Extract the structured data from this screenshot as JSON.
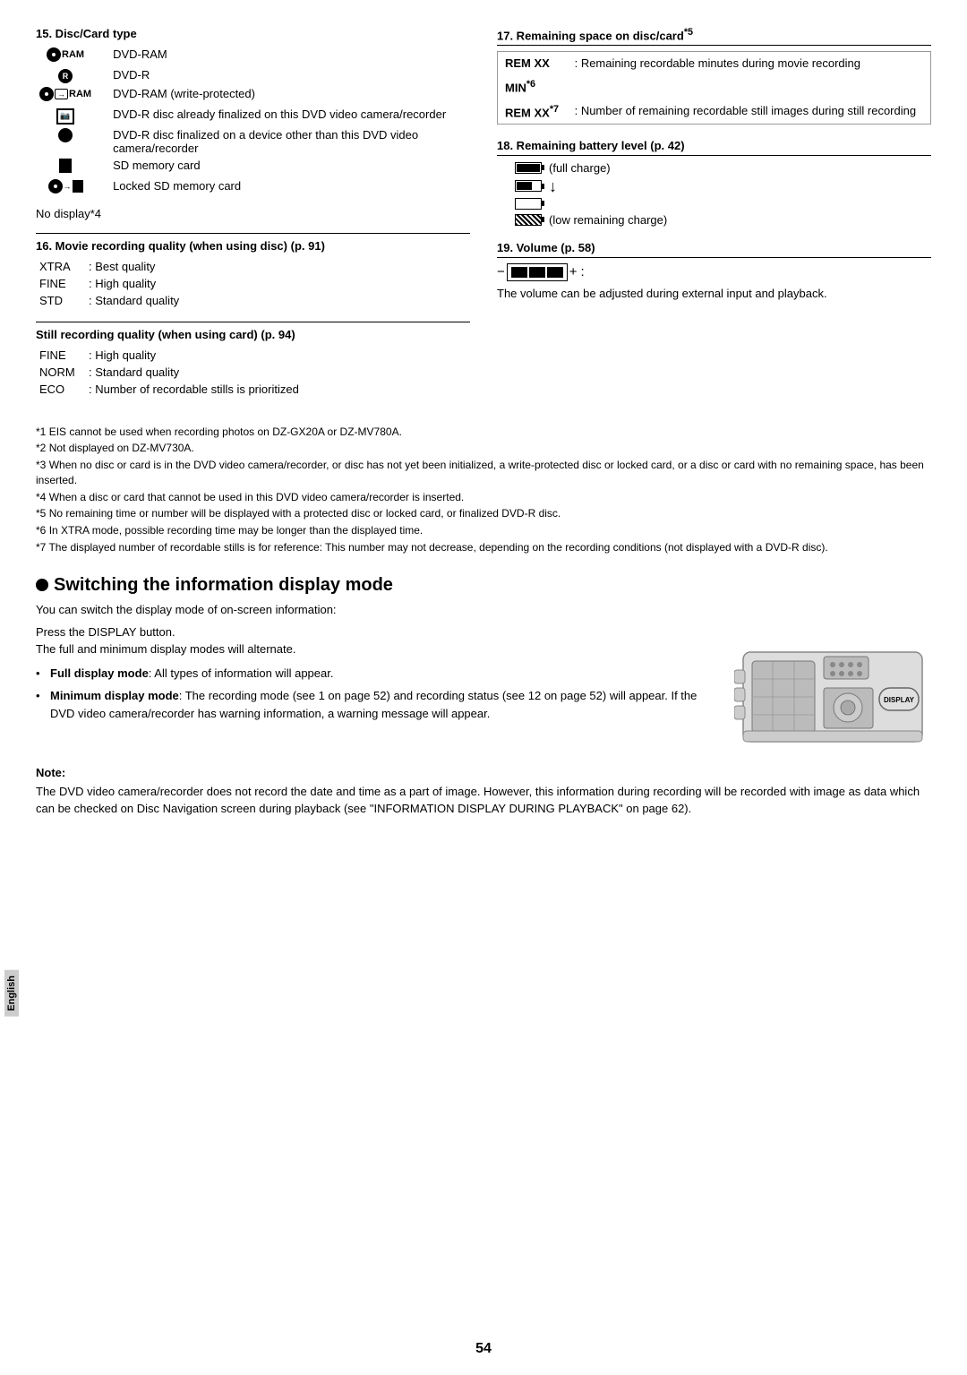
{
  "page": {
    "number": "54",
    "language_label": "English"
  },
  "section15": {
    "title": "15. Disc/Card type",
    "items": [
      {
        "icon_type": "ram",
        "description": ": DVD-RAM"
      },
      {
        "icon_type": "r",
        "description": ": DVD-R"
      },
      {
        "icon_type": "ram_wp",
        "description": ": DVD-RAM (write-protected)"
      },
      {
        "icon_type": "finalized_cam",
        "description": ": DVD-R disc already finalized on this DVD video camera/recorder"
      },
      {
        "icon_type": "circle_filled",
        "description": ": DVD-R disc finalized on a device other than this DVD video camera/recorder"
      },
      {
        "icon_type": "black_sq",
        "description": ": SD memory card"
      },
      {
        "icon_type": "locked_sd",
        "description": ": Locked SD memory card"
      }
    ],
    "no_display": "No display*4"
  },
  "section16": {
    "title": "16. Movie recording quality (when using disc)",
    "page_ref": "(p. 91)",
    "items": [
      {
        "label": "XTRA",
        "desc": ": Best quality"
      },
      {
        "label": "FINE",
        "desc": ": High quality"
      },
      {
        "label": "STD",
        "desc": ": Standard quality"
      }
    ],
    "still_title": "Still recording quality (when using card)",
    "still_page_ref": "(p. 94)",
    "still_items": [
      {
        "label": "FINE",
        "desc": ": High quality"
      },
      {
        "label": "NORM",
        "desc": ": Standard quality"
      },
      {
        "label": "ECO",
        "desc": ": Number of recordable stills is prioritized"
      }
    ]
  },
  "section17": {
    "title": "17. Remaining space on disc/card",
    "title_sup": "*5",
    "rows": [
      {
        "label": "REM XX",
        "desc": ": Remaining recordable minutes"
      },
      {
        "label": "MIN*6",
        "desc": "during movie recording"
      },
      {
        "label": "REM XX*7",
        "desc": ": Number of remaining recordable still images during still recording"
      }
    ]
  },
  "section18": {
    "title": "18. Remaining battery level (p. 42)",
    "battery_levels": [
      {
        "icon": "full",
        "label": "(full charge)"
      },
      {
        "icon": "half",
        "label": ""
      },
      {
        "icon": "arrow",
        "label": ""
      },
      {
        "icon": "empty",
        "label": ""
      },
      {
        "icon": "low",
        "label": "(low remaining charge)"
      }
    ]
  },
  "section19": {
    "title": "19. Volume (p. 58)",
    "bar_segments": 3,
    "description": "The volume can be adjusted during external input and playback."
  },
  "footnotes": [
    {
      "ref": "*1",
      "text": "EIS cannot be used when recording photos on DZ-GX20A or DZ-MV780A."
    },
    {
      "ref": "*2",
      "text": "Not displayed on DZ-MV730A."
    },
    {
      "ref": "*3",
      "text": "When no disc or card is in the DVD video camera/recorder, or disc has not yet been initialized, a write-protected disc or locked card, or a disc or card with no remaining space, has been inserted."
    },
    {
      "ref": "*4",
      "text": "When a disc or card that cannot be used in this DVD video camera/recorder is inserted."
    },
    {
      "ref": "*5",
      "text": "No remaining time or number will be displayed with a protected disc or locked card, or finalized DVD-R disc."
    },
    {
      "ref": "*6",
      "text": "In XTRA mode, possible recording time may be longer than the displayed time."
    },
    {
      "ref": "*7",
      "text": "The displayed number of recordable stills is for reference: This number may not decrease, depending on the recording conditions (not displayed with a DVD-R disc)."
    }
  ],
  "switching": {
    "title": "Switching the information display mode",
    "intro": "You can switch the display mode of on-screen information:",
    "press_label": "Press the DISPLAY button.",
    "alternate_label": "The full and minimum display modes will alternate.",
    "bullet1_bold": "Full display mode",
    "bullet1_text": ": All types of information will appear.",
    "bullet2_bold": "Minimum display mode",
    "bullet2_text": ": The recording mode (see 1 on page 52) and recording status (see 12 on page 52) will appear. If the DVD video camera/recorder has warning information, a warning message will appear."
  },
  "note": {
    "title": "Note:",
    "text": "The DVD video camera/recorder does not record the date and time as a part of image. However, this information during recording will be recorded with image as data which can be checked on Disc Navigation screen during playback (see \"INFORMATION DISPLAY DURING PLAYBACK\" on page 62)."
  }
}
